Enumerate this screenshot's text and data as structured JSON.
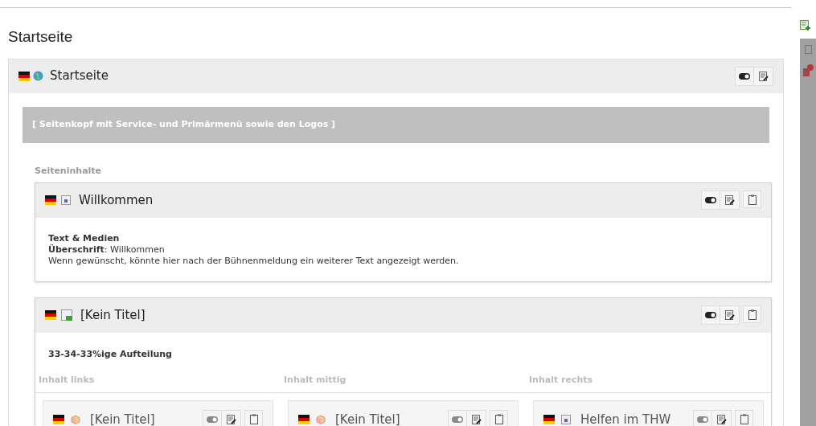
{
  "page_title": "Startseite",
  "page_panel": {
    "title": "Startseite",
    "header_block": "[ Seitenkopf mit Service- und Primärmenü sowie den Logos ]",
    "section_label": "Seiteninhalte"
  },
  "elements": [
    {
      "kind": "text",
      "title": "Willkommen",
      "type_label": "Text & Medien",
      "field_label": "Überschrift",
      "field_value": ": Willkommen",
      "body": "Wenn gewünscht, könnte hier nach der Bühnenmeldung ein weiterer Text angezeigt werden."
    },
    {
      "kind": "grid",
      "title": "[Kein Titel]",
      "type_label": "33-34-33%ige Aufteilung",
      "columns": [
        {
          "label": "Inhalt links",
          "items": [
            {
              "kind": "box",
              "title": "[Kein Titel]"
            }
          ]
        },
        {
          "label": "Inhalt mittig",
          "items": [
            {
              "kind": "box",
              "title": "[Kein Titel]"
            }
          ]
        },
        {
          "label": "Inhalt rechts",
          "items": [
            {
              "kind": "text",
              "title": "Helfen im THW"
            }
          ]
        }
      ]
    }
  ]
}
